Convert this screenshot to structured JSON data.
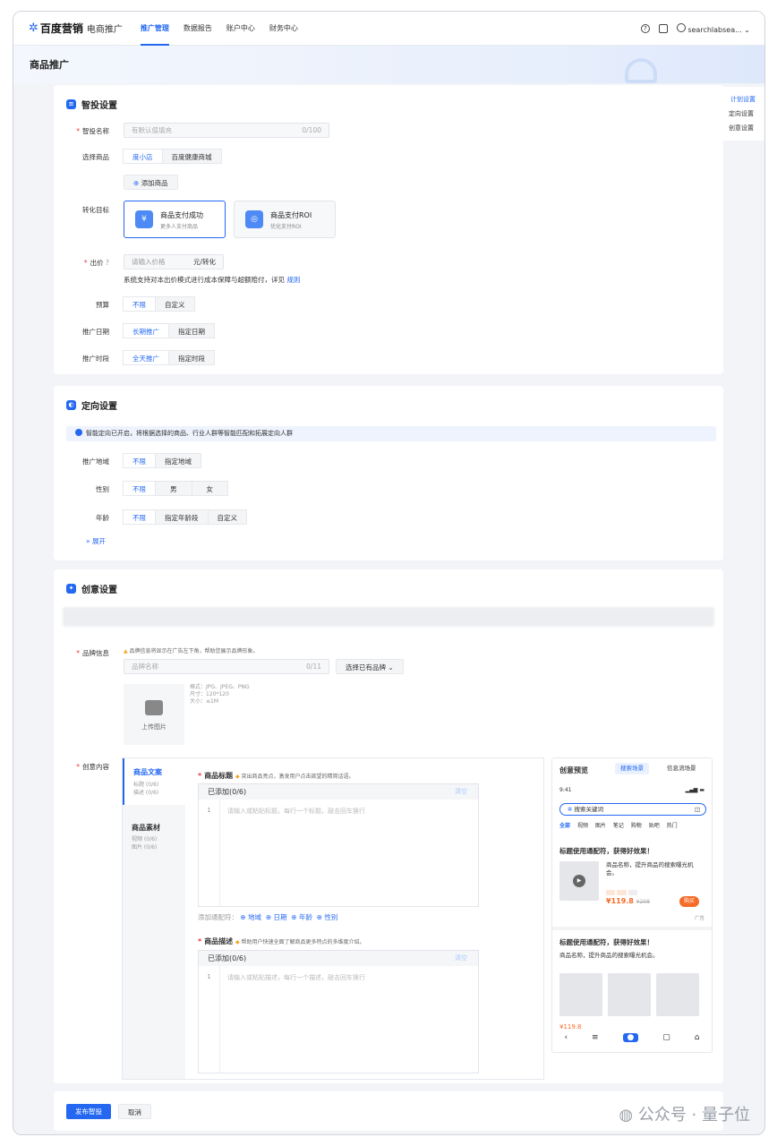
{
  "topbar": {
    "brand": "百度营销",
    "brand_sub": "电商推广",
    "nav": [
      "推广管理",
      "数据报告",
      "账户中心",
      "财务中心"
    ],
    "user": "searchlabsea..."
  },
  "page": {
    "title": "商品推广"
  },
  "right_nav": [
    "计划设置",
    "定向设置",
    "创意设置"
  ],
  "smart": {
    "title": "智投设置",
    "name_label": "智投名称",
    "name_placeholder": "有默认值填充",
    "name_count": "0/100",
    "product_label": "选择商品",
    "product_tabs": [
      "度小店",
      "百度健康商城"
    ],
    "add_product": "添加商品",
    "goal_label": "转化目标",
    "goals": [
      {
        "title": "商品支付成功",
        "sub": "更多人支付商品"
      },
      {
        "title": "商品支付ROI",
        "sub": "优化支付ROI"
      }
    ],
    "bid_label": "出价",
    "bid_placeholder": "请输入价格",
    "bid_unit": "元/转化",
    "bid_note": "系统支持对本出价模式进行成本保障与超额赔付，详见",
    "bid_link": "规则",
    "budget_label": "预算",
    "budget_opts": [
      "不限",
      "自定义"
    ],
    "date_label": "推广日期",
    "date_opts": [
      "长期推广",
      "指定日期"
    ],
    "time_label": "推广时段",
    "time_opts": [
      "全天推广",
      "指定时段"
    ]
  },
  "target": {
    "title": "定向设置",
    "info": "智能定向已开启，将根据选择的商品、行业人群等智能匹配和拓展定向人群",
    "region_label": "推广地域",
    "region_opts": [
      "不限",
      "指定地域"
    ],
    "gender_label": "性别",
    "gender_opts": [
      "不限",
      "男",
      "女"
    ],
    "age_label": "年龄",
    "age_opts": [
      "不限",
      "指定年龄段",
      "自定义"
    ],
    "expand": "展开"
  },
  "creative": {
    "title": "创意设置",
    "brand_label": "品牌信息",
    "brand_tip": "品牌信息将显示在广告左下角，帮助您展示品牌形象。",
    "brand_placeholder": "品牌名称",
    "brand_count": "0/11",
    "brand_select": "选择已有品牌",
    "upload_label": "上传图片",
    "upload_rules": [
      "格式：JPG、JPEG、PNG",
      "尺寸：120*120",
      "大小：≤1M"
    ],
    "content_label": "创意内容",
    "side": {
      "copy_title": "商品文案",
      "copy_items": [
        "标题 (0/6)",
        "描述 (0/6)"
      ],
      "mat_title": "商品素材",
      "mat_items": [
        "视频 (0/6)",
        "图片 (0/6)"
      ]
    },
    "title_label": "商品标题",
    "title_tip": "突出商品亮点，激发用户点击欲望的精简话语。",
    "added_title": "已添加(0/6)",
    "clear": "清空",
    "title_placeholder": "请输入或粘贴标题，每行一个标题，敲击回车换行",
    "wildcard_label": "添加通配符：",
    "wildcards": [
      "地域",
      "日期",
      "年龄",
      "性别"
    ],
    "desc_label": "商品描述",
    "desc_tip": "帮助用户快速全面了解商品更多特点的多维度介绍。",
    "added_desc": "已添加(0/6)",
    "desc_placeholder": "请输入或粘贴描述，每行一个描述，敲击回车换行",
    "line_no": "1"
  },
  "preview": {
    "title": "创意预览",
    "tabs": [
      "搜索场景",
      "信息流场景"
    ],
    "time": "9:41",
    "search": "搜索关键词",
    "cats": [
      "全部",
      "视频",
      "图片",
      "笔记",
      "购物",
      "贴吧",
      "热门"
    ],
    "ad_title": "标题使用通配符，获得好效果！",
    "ad_desc": "商品名称，提升商品的搜索曝光机会。",
    "price": "¥119.8",
    "old_price": "¥208",
    "buy": "购买",
    "ad_mark": "广告",
    "ad2_title": "标题使用通配符，获得好效果！",
    "ad2_desc": "商品名称，提升商品的搜索曝光机会。",
    "price2": "¥119.8"
  },
  "footer": {
    "publish": "发布智投",
    "cancel": "取消"
  },
  "watermark": "公众号 · 量子位"
}
